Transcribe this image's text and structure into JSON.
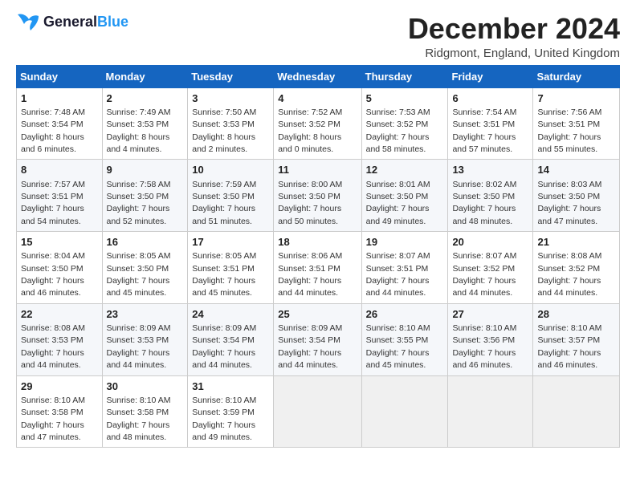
{
  "header": {
    "logo_general": "General",
    "logo_blue": "Blue",
    "title": "December 2024",
    "location": "Ridgmont, England, United Kingdom"
  },
  "weekdays": [
    "Sunday",
    "Monday",
    "Tuesday",
    "Wednesday",
    "Thursday",
    "Friday",
    "Saturday"
  ],
  "weeks": [
    [
      {
        "day": "1",
        "sunrise": "Sunrise: 7:48 AM",
        "sunset": "Sunset: 3:54 PM",
        "daylight": "Daylight: 8 hours and 6 minutes."
      },
      {
        "day": "2",
        "sunrise": "Sunrise: 7:49 AM",
        "sunset": "Sunset: 3:53 PM",
        "daylight": "Daylight: 8 hours and 4 minutes."
      },
      {
        "day": "3",
        "sunrise": "Sunrise: 7:50 AM",
        "sunset": "Sunset: 3:53 PM",
        "daylight": "Daylight: 8 hours and 2 minutes."
      },
      {
        "day": "4",
        "sunrise": "Sunrise: 7:52 AM",
        "sunset": "Sunset: 3:52 PM",
        "daylight": "Daylight: 8 hours and 0 minutes."
      },
      {
        "day": "5",
        "sunrise": "Sunrise: 7:53 AM",
        "sunset": "Sunset: 3:52 PM",
        "daylight": "Daylight: 7 hours and 58 minutes."
      },
      {
        "day": "6",
        "sunrise": "Sunrise: 7:54 AM",
        "sunset": "Sunset: 3:51 PM",
        "daylight": "Daylight: 7 hours and 57 minutes."
      },
      {
        "day": "7",
        "sunrise": "Sunrise: 7:56 AM",
        "sunset": "Sunset: 3:51 PM",
        "daylight": "Daylight: 7 hours and 55 minutes."
      }
    ],
    [
      {
        "day": "8",
        "sunrise": "Sunrise: 7:57 AM",
        "sunset": "Sunset: 3:51 PM",
        "daylight": "Daylight: 7 hours and 54 minutes."
      },
      {
        "day": "9",
        "sunrise": "Sunrise: 7:58 AM",
        "sunset": "Sunset: 3:50 PM",
        "daylight": "Daylight: 7 hours and 52 minutes."
      },
      {
        "day": "10",
        "sunrise": "Sunrise: 7:59 AM",
        "sunset": "Sunset: 3:50 PM",
        "daylight": "Daylight: 7 hours and 51 minutes."
      },
      {
        "day": "11",
        "sunrise": "Sunrise: 8:00 AM",
        "sunset": "Sunset: 3:50 PM",
        "daylight": "Daylight: 7 hours and 50 minutes."
      },
      {
        "day": "12",
        "sunrise": "Sunrise: 8:01 AM",
        "sunset": "Sunset: 3:50 PM",
        "daylight": "Daylight: 7 hours and 49 minutes."
      },
      {
        "day": "13",
        "sunrise": "Sunrise: 8:02 AM",
        "sunset": "Sunset: 3:50 PM",
        "daylight": "Daylight: 7 hours and 48 minutes."
      },
      {
        "day": "14",
        "sunrise": "Sunrise: 8:03 AM",
        "sunset": "Sunset: 3:50 PM",
        "daylight": "Daylight: 7 hours and 47 minutes."
      }
    ],
    [
      {
        "day": "15",
        "sunrise": "Sunrise: 8:04 AM",
        "sunset": "Sunset: 3:50 PM",
        "daylight": "Daylight: 7 hours and 46 minutes."
      },
      {
        "day": "16",
        "sunrise": "Sunrise: 8:05 AM",
        "sunset": "Sunset: 3:50 PM",
        "daylight": "Daylight: 7 hours and 45 minutes."
      },
      {
        "day": "17",
        "sunrise": "Sunrise: 8:05 AM",
        "sunset": "Sunset: 3:51 PM",
        "daylight": "Daylight: 7 hours and 45 minutes."
      },
      {
        "day": "18",
        "sunrise": "Sunrise: 8:06 AM",
        "sunset": "Sunset: 3:51 PM",
        "daylight": "Daylight: 7 hours and 44 minutes."
      },
      {
        "day": "19",
        "sunrise": "Sunrise: 8:07 AM",
        "sunset": "Sunset: 3:51 PM",
        "daylight": "Daylight: 7 hours and 44 minutes."
      },
      {
        "day": "20",
        "sunrise": "Sunrise: 8:07 AM",
        "sunset": "Sunset: 3:52 PM",
        "daylight": "Daylight: 7 hours and 44 minutes."
      },
      {
        "day": "21",
        "sunrise": "Sunrise: 8:08 AM",
        "sunset": "Sunset: 3:52 PM",
        "daylight": "Daylight: 7 hours and 44 minutes."
      }
    ],
    [
      {
        "day": "22",
        "sunrise": "Sunrise: 8:08 AM",
        "sunset": "Sunset: 3:53 PM",
        "daylight": "Daylight: 7 hours and 44 minutes."
      },
      {
        "day": "23",
        "sunrise": "Sunrise: 8:09 AM",
        "sunset": "Sunset: 3:53 PM",
        "daylight": "Daylight: 7 hours and 44 minutes."
      },
      {
        "day": "24",
        "sunrise": "Sunrise: 8:09 AM",
        "sunset": "Sunset: 3:54 PM",
        "daylight": "Daylight: 7 hours and 44 minutes."
      },
      {
        "day": "25",
        "sunrise": "Sunrise: 8:09 AM",
        "sunset": "Sunset: 3:54 PM",
        "daylight": "Daylight: 7 hours and 44 minutes."
      },
      {
        "day": "26",
        "sunrise": "Sunrise: 8:10 AM",
        "sunset": "Sunset: 3:55 PM",
        "daylight": "Daylight: 7 hours and 45 minutes."
      },
      {
        "day": "27",
        "sunrise": "Sunrise: 8:10 AM",
        "sunset": "Sunset: 3:56 PM",
        "daylight": "Daylight: 7 hours and 46 minutes."
      },
      {
        "day": "28",
        "sunrise": "Sunrise: 8:10 AM",
        "sunset": "Sunset: 3:57 PM",
        "daylight": "Daylight: 7 hours and 46 minutes."
      }
    ],
    [
      {
        "day": "29",
        "sunrise": "Sunrise: 8:10 AM",
        "sunset": "Sunset: 3:58 PM",
        "daylight": "Daylight: 7 hours and 47 minutes."
      },
      {
        "day": "30",
        "sunrise": "Sunrise: 8:10 AM",
        "sunset": "Sunset: 3:58 PM",
        "daylight": "Daylight: 7 hours and 48 minutes."
      },
      {
        "day": "31",
        "sunrise": "Sunrise: 8:10 AM",
        "sunset": "Sunset: 3:59 PM",
        "daylight": "Daylight: 7 hours and 49 minutes."
      },
      null,
      null,
      null,
      null
    ]
  ]
}
